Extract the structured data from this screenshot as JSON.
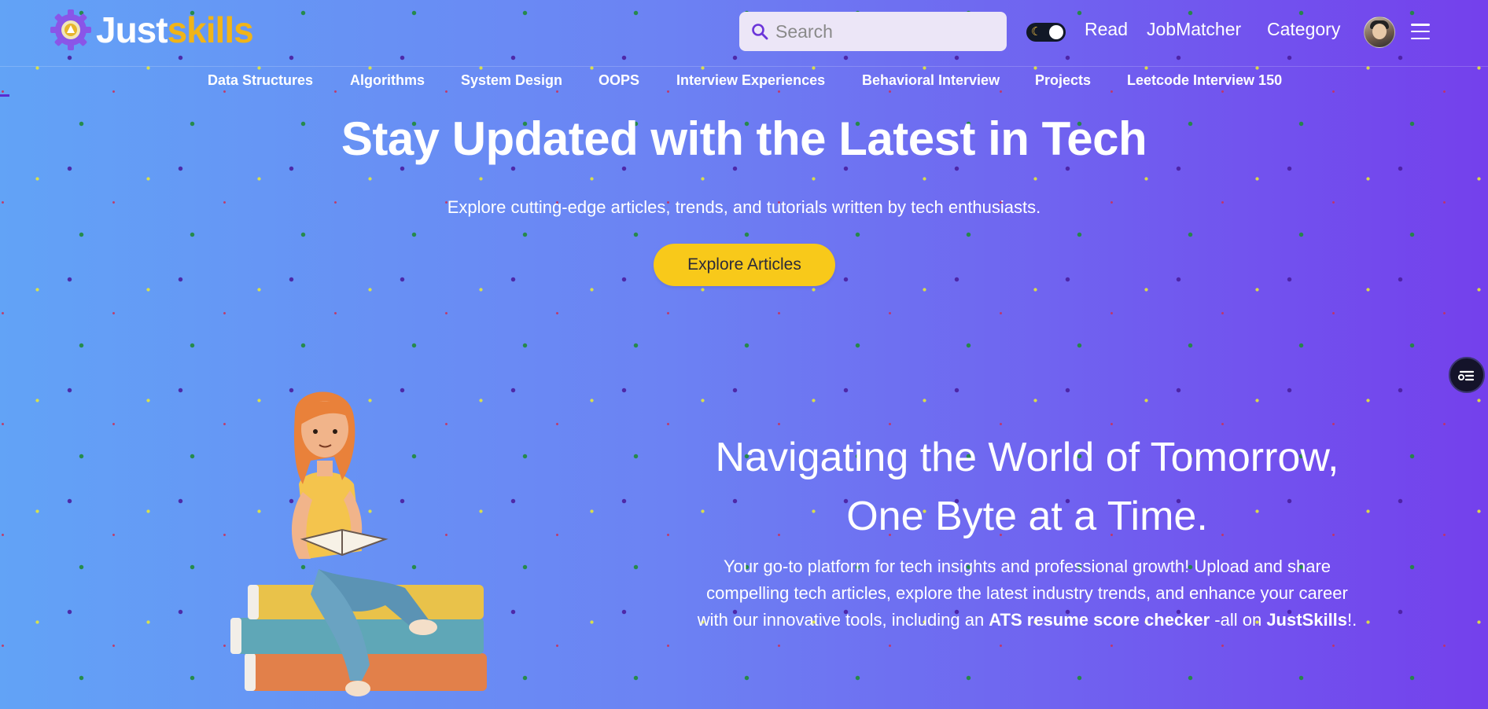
{
  "brand": {
    "part1": "Just",
    "part2": "skills"
  },
  "search": {
    "placeholder": "Search"
  },
  "nav": {
    "read": "Read",
    "jobmatcher": "JobMatcher",
    "category": "Category"
  },
  "subnav": [
    "Data Structures",
    "Algorithms",
    "System Design",
    "OOPS",
    "Interview Experiences",
    "Behavioral Interview",
    "Projects",
    "Leetcode Interview 150"
  ],
  "hero": {
    "title": "Stay Updated with the Latest in Tech",
    "subtitle": "Explore cutting-edge articles, trends, and tutorials written by tech enthusiasts.",
    "cta": "Explore Articles"
  },
  "tagline": {
    "line1": "Navigating the World of Tomorrow,",
    "line2": "One Byte at a Time.",
    "desc_pre": "Your go-to platform for tech insights and professional growth! Upload and share compelling tech articles, explore the latest industry trends, and enhance your career with our innovative tools, including an ",
    "desc_bold1": "ATS resume score checker",
    "desc_mid": " -all on ",
    "desc_bold2": "JustSkills",
    "desc_end": "!."
  },
  "colors": {
    "accent": "#f8c91a",
    "brand_yellow": "#f0b418",
    "bg_left": "#62a3f6",
    "bg_right": "#7440ec"
  },
  "icons": [
    "gear-logo-icon",
    "search-icon",
    "moon-icon",
    "hamburger-menu-icon",
    "table-of-contents-icon"
  ]
}
